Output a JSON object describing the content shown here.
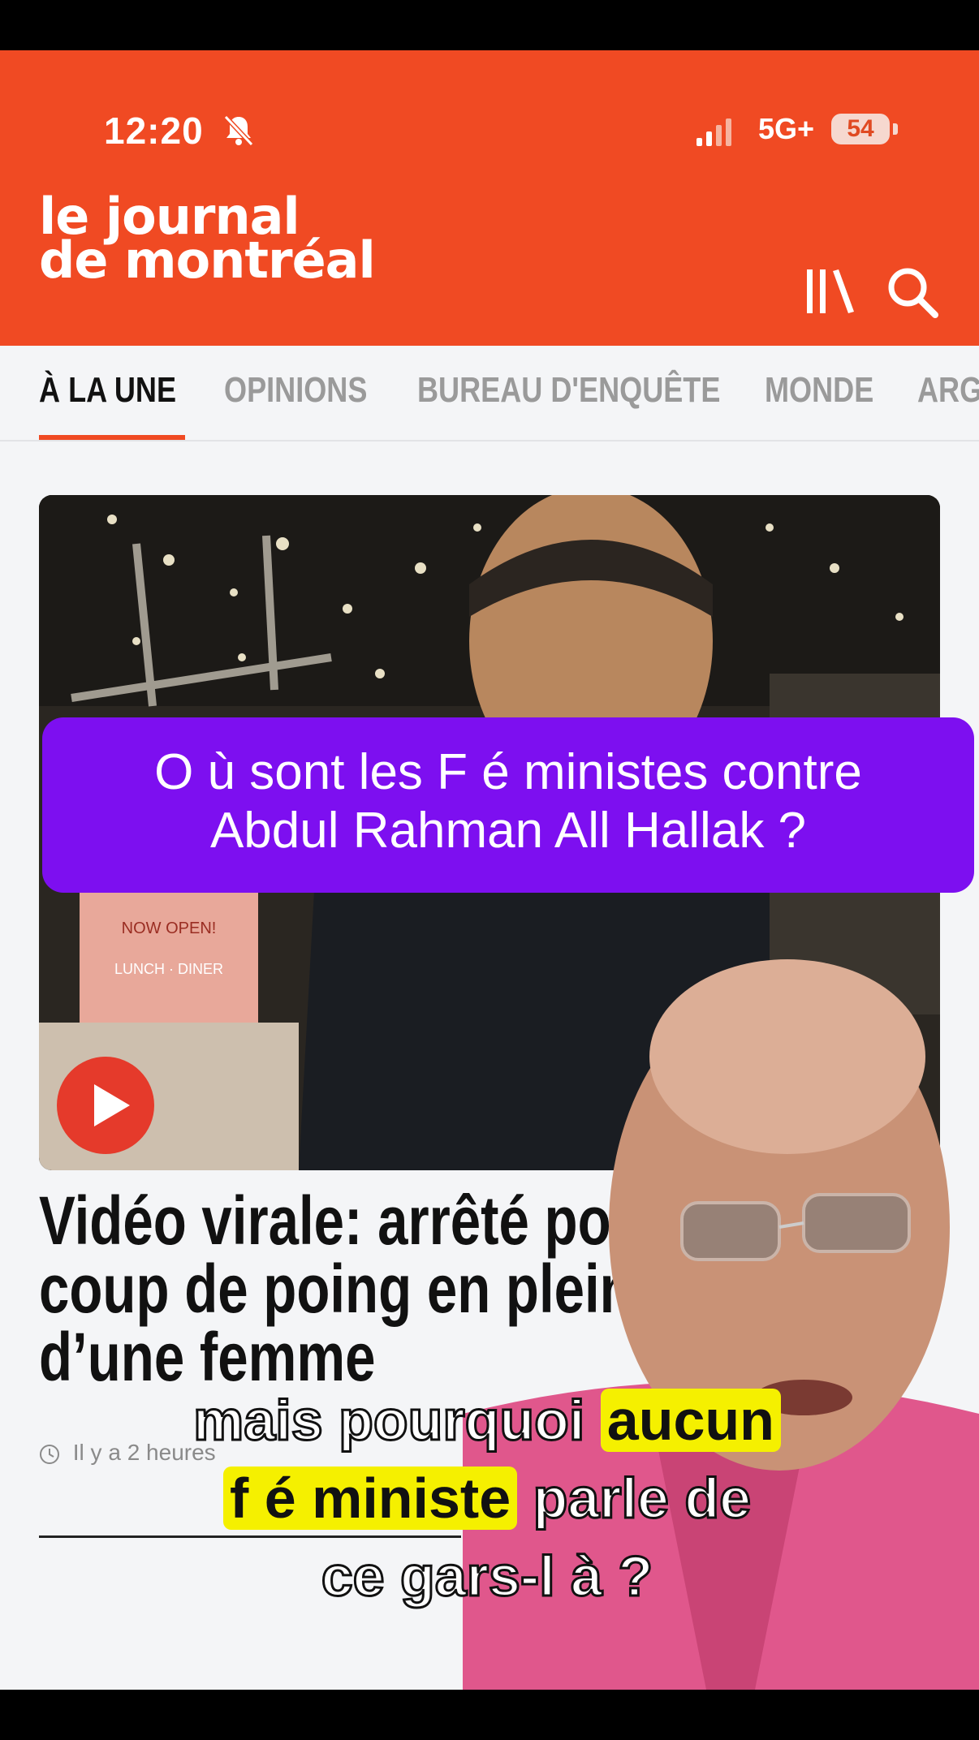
{
  "status_bar": {
    "time": "12:20",
    "network": "5G+",
    "battery": "54"
  },
  "header": {
    "logo_line1": "le journal",
    "logo_line2": "de montréal"
  },
  "nav": {
    "tabs": [
      {
        "label": "À LA UNE"
      },
      {
        "label": "OPINIONS"
      },
      {
        "label": "BUREAU D'ENQUÊTE"
      },
      {
        "label": "MONDE"
      },
      {
        "label": "ARG"
      }
    ]
  },
  "article": {
    "image_sign": "NOW OPEN! LUNCH · DINER",
    "title_line1": "Vidéo virale: arrêté pour",
    "title_line2": "coup de poing en plein vis",
    "title_line3": "d’une femme",
    "time_ago": "Il y a 2 heures"
  },
  "overlay": {
    "banner_line1": "O ù  sont les F é ministes contre",
    "banner_line2": "Abdul Rahman All Hallak ?",
    "caption_part1": "mais pourquoi",
    "caption_highlight1": "aucun",
    "caption_highlight2": "f é ministe",
    "caption_part2": "parle de",
    "caption_line3": "ce gars-l à  ?"
  },
  "colors": {
    "brand": "#f04a23",
    "banner": "#7d0ff0",
    "highlight": "#f5f000"
  },
  "icons": [
    "bell-slash-icon",
    "signal-icon",
    "library-icon",
    "search-icon",
    "play-icon",
    "clock-icon"
  ]
}
